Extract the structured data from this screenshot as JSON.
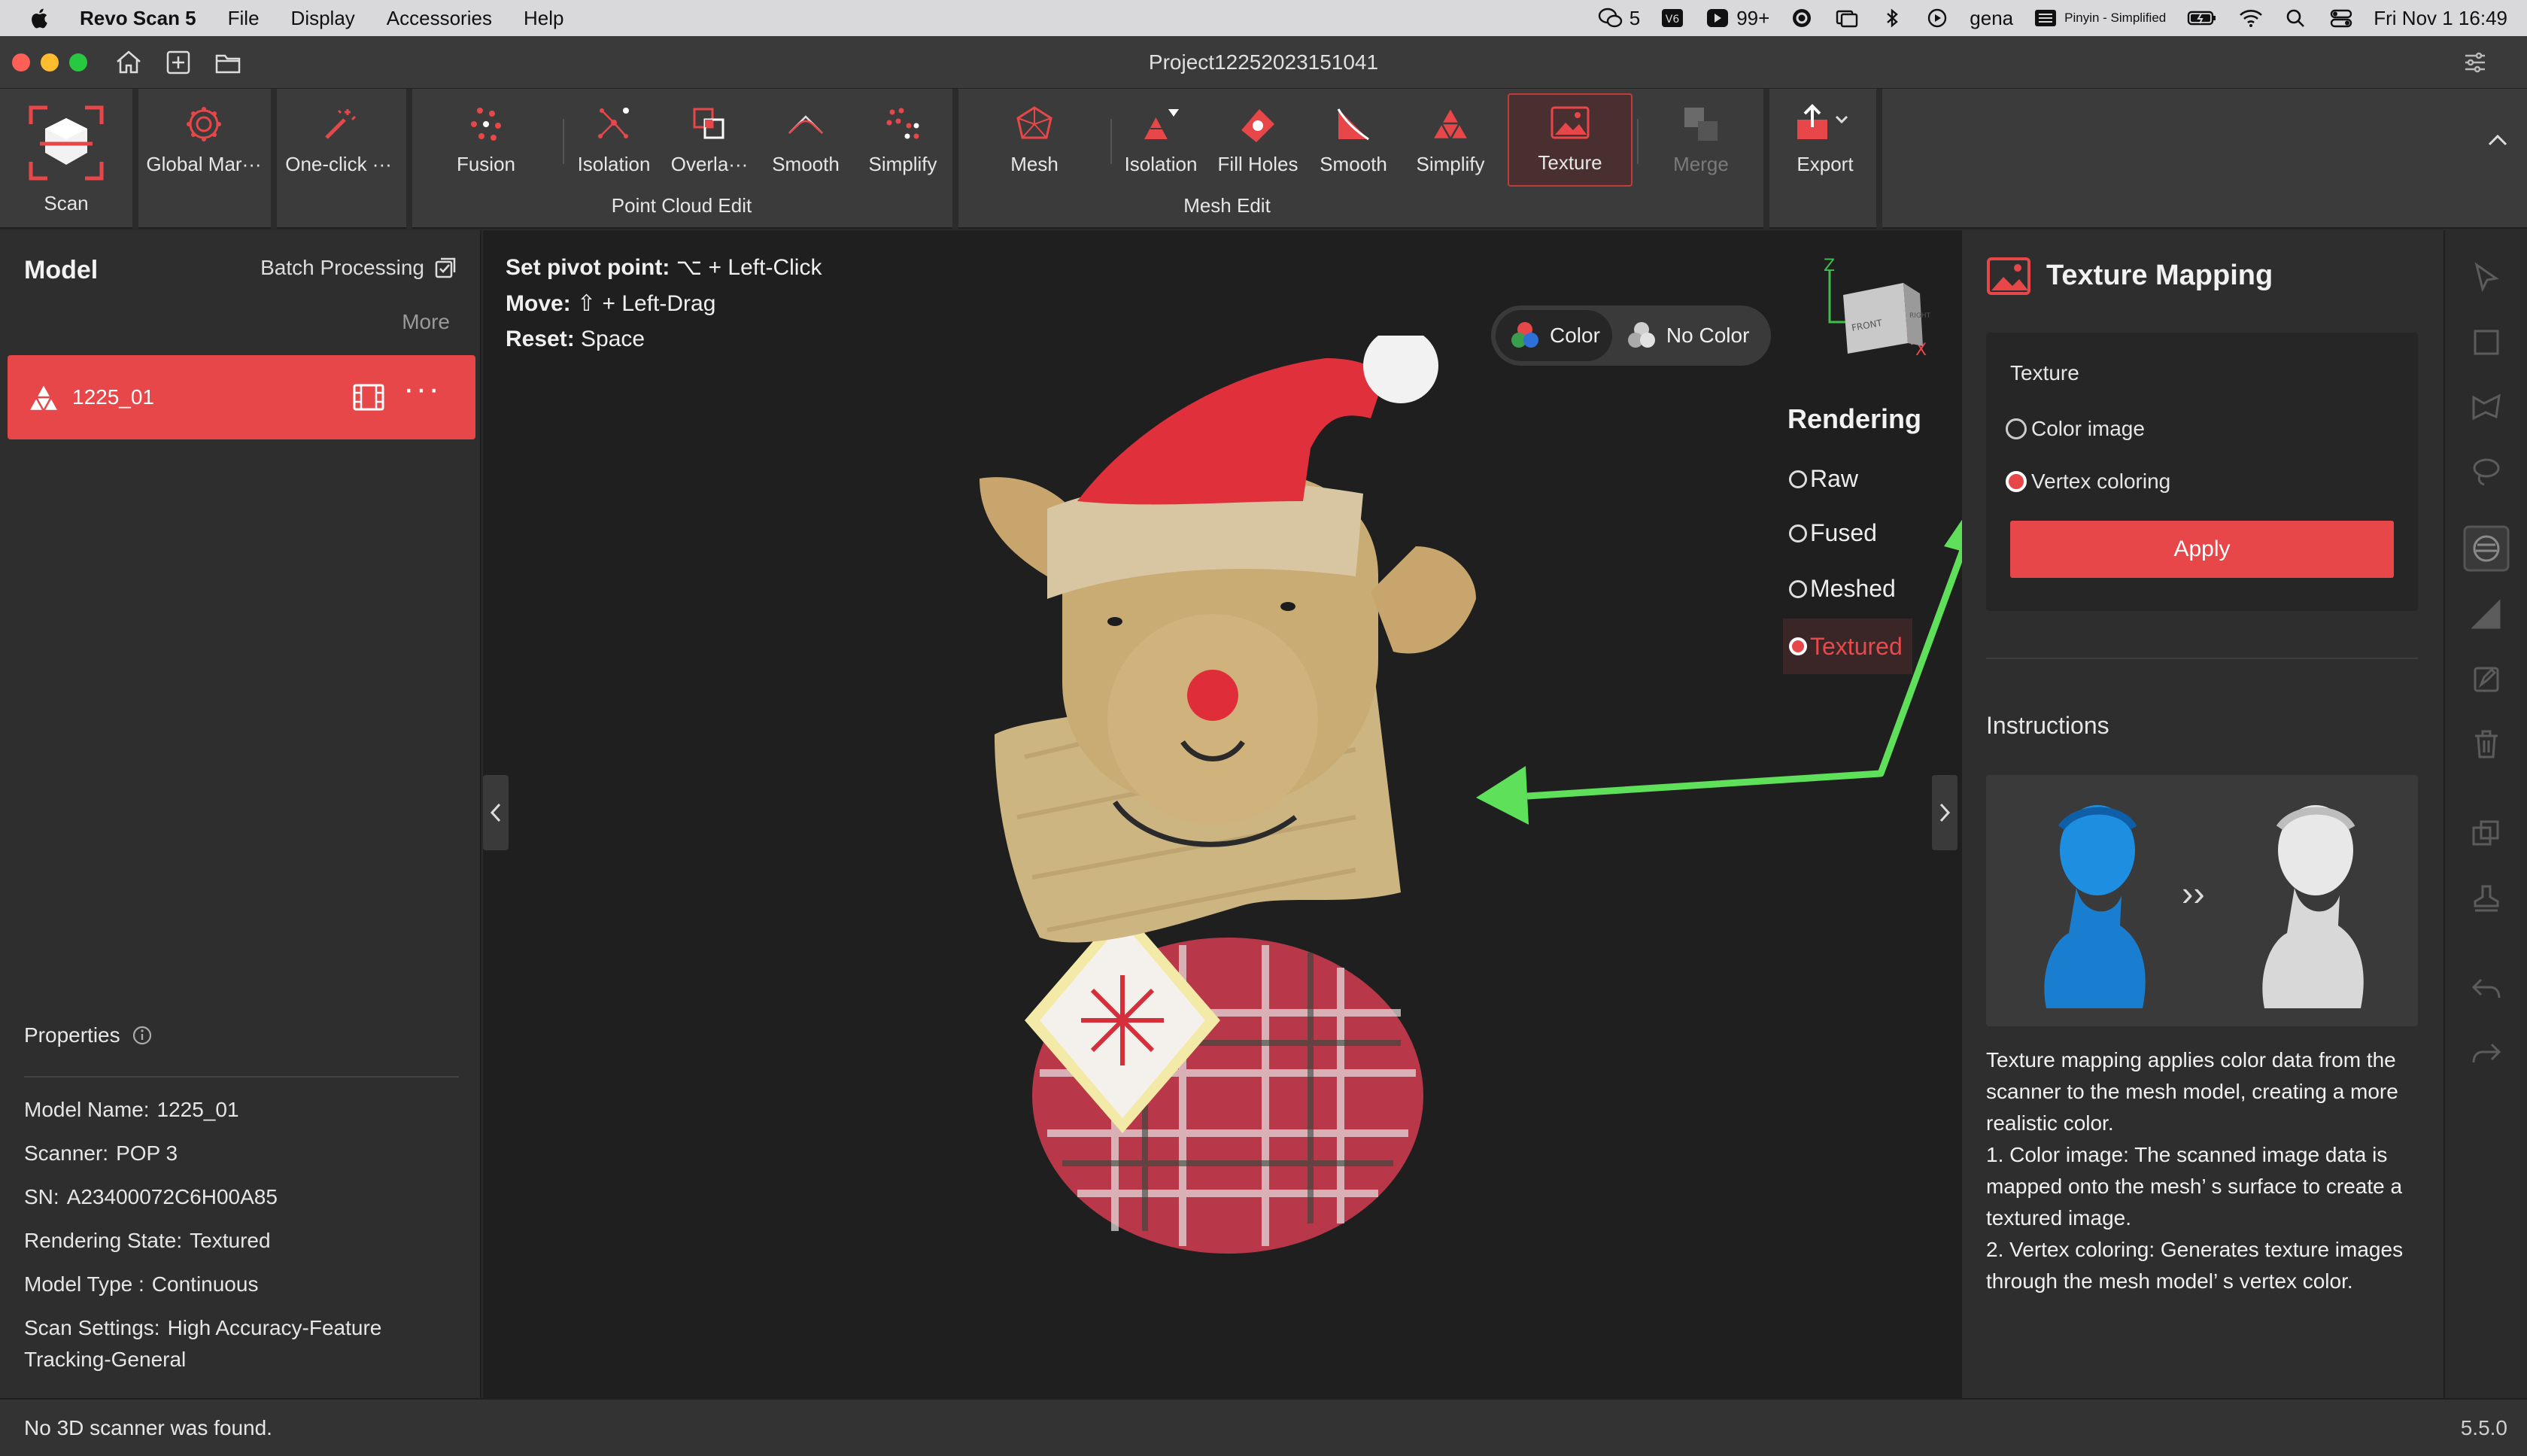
{
  "menubar": {
    "app_name": "Revo Scan 5",
    "items": [
      "File",
      "Display",
      "Accessories",
      "Help"
    ],
    "status": {
      "wechat_count": "5",
      "vpn_label": "V6",
      "notif_count": "99+",
      "user": "gena",
      "input_method": "Pinyin - Simplified",
      "datetime": "Fri Nov 1  16:49"
    }
  },
  "window": {
    "title": "Project12252023151041"
  },
  "ribbon": {
    "scan": "Scan",
    "global_markers": "Global Mar···",
    "one_click": "One-click ···",
    "fusion": "Fusion",
    "pc_isolation": "Isolation",
    "pc_overlap": "Overla···",
    "pc_smooth": "Smooth",
    "pc_simplify": "Simplify",
    "point_cloud_group": "Point Cloud Edit",
    "mesh": "Mesh",
    "mesh_isolation": "Isolation",
    "fill_holes": "Fill Holes",
    "mesh_smooth": "Smooth",
    "mesh_simplify": "Simplify",
    "texture": "Texture",
    "merge": "Merge",
    "mesh_group": "Mesh Edit",
    "export": "Export"
  },
  "left_panel": {
    "title": "Model",
    "batch": "Batch Processing",
    "more": "More",
    "model_item": "1225_01",
    "more_dots": "···",
    "properties_title": "Properties",
    "properties": [
      {
        "key": "Model Name:",
        "value": "1225_01"
      },
      {
        "key": "Scanner:",
        "value": "POP 3"
      },
      {
        "key": "SN:",
        "value": "A23400072C6H00A85"
      },
      {
        "key": "Rendering State:",
        "value": "Textured"
      },
      {
        "key": "Model Type :",
        "value": "Continuous"
      },
      {
        "key": "Scan Settings:",
        "value": "High Accuracy-Feature Tracking-General"
      }
    ]
  },
  "viewport": {
    "hints": [
      {
        "label": "Set pivot point:",
        "value": "⌥ + Left-Click"
      },
      {
        "label": "Move:",
        "value": "⇧ + Left-Drag"
      },
      {
        "label": "Reset:",
        "value": "Space"
      }
    ],
    "color_toggle": {
      "color": "Color",
      "no_color": "No Color",
      "selected": "Color"
    },
    "rendering_title": "Rendering",
    "rendering_options": [
      "Raw",
      "Fused",
      "Meshed",
      "Textured"
    ],
    "rendering_selected": "Textured",
    "cube": {
      "z": "Z",
      "x": "X",
      "front": "FRONT",
      "right": "RIGHT"
    }
  },
  "right_panel": {
    "title": "Texture Mapping",
    "texture_label": "Texture",
    "options": [
      "Color image",
      "Vertex coloring"
    ],
    "selected": "Vertex coloring",
    "apply": "Apply",
    "instructions_title": "Instructions",
    "instructions_arrow": "››",
    "instructions_text": [
      "Texture mapping applies color data from the scanner to the mesh model, creating a more realistic color.",
      "1. Color image: The scanned image data is mapped onto the mesh’ s surface to create a textured image.",
      "2. Vertex coloring: Generates texture images through the mesh model’ s vertex color."
    ]
  },
  "statusbar": {
    "message": "No 3D scanner was found.",
    "version": "5.5.0"
  },
  "colors": {
    "accent": "#e8474a",
    "arrow": "#5fe05a"
  }
}
